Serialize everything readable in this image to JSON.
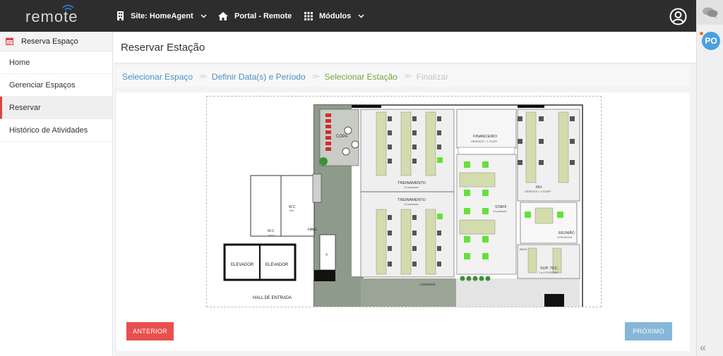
{
  "header": {
    "logo": "remote",
    "site_label": "Site: HomeAgent",
    "portal_label": "Portal - Remote",
    "modules_label": "Módulos"
  },
  "rail": {
    "avatar_initials": "PO"
  },
  "sidebar": {
    "title": "Reserva Espaço",
    "items": [
      {
        "label": "Home"
      },
      {
        "label": "Gerenciar Espaços"
      },
      {
        "label": "Reservar"
      },
      {
        "label": "Histórico de Atividades"
      }
    ]
  },
  "main": {
    "page_title": "Reservar Estação",
    "steps": [
      {
        "label": "Selecionar Espaço"
      },
      {
        "label": "Definir Data(s) e Período"
      },
      {
        "label": "Selecionar Estação"
      },
      {
        "label": "Finalizar"
      }
    ],
    "step_separator": ">>",
    "floorplan": {
      "labels": {
        "copa": "COPA",
        "financeiro": "FINANCEIRO",
        "financeiro_sub": "GERENTE + 1 STAFF",
        "treinamento_1": "TREINAMENTO",
        "treinamento_1_sub": "12 pessoas",
        "treinamento_2": "TREINAMENTO",
        "treinamento_2_sub": "12 pessoas",
        "rh": "RH",
        "rh_sub": "GERENTE + 4 STAFF",
        "staff": "STAFF",
        "staff_sub": "12 pessoas",
        "reuniao": "REUNIÃO",
        "reuniao_sub": "3 PESSOAS",
        "sup_tec": "SUP. TEC.",
        "sup_tec_sub": "2 a 4 PESSOAS",
        "wc_fem": "W.C",
        "wc_fem_sub": "fem.",
        "wc_masc": "W.C",
        "wc_masc_sub": "masc.",
        "hall": "HALL",
        "elevador_1": "ELEVADOR",
        "elevador_2": "ELEVADOR",
        "hall_entrada": "HALL DE ENTRADA",
        "lockers": "LOCKERS",
        "rack": "RACK",
        "v": "V"
      }
    },
    "buttons": {
      "previous": "ANTERIOR",
      "next": "PRÓXIMO"
    }
  }
}
